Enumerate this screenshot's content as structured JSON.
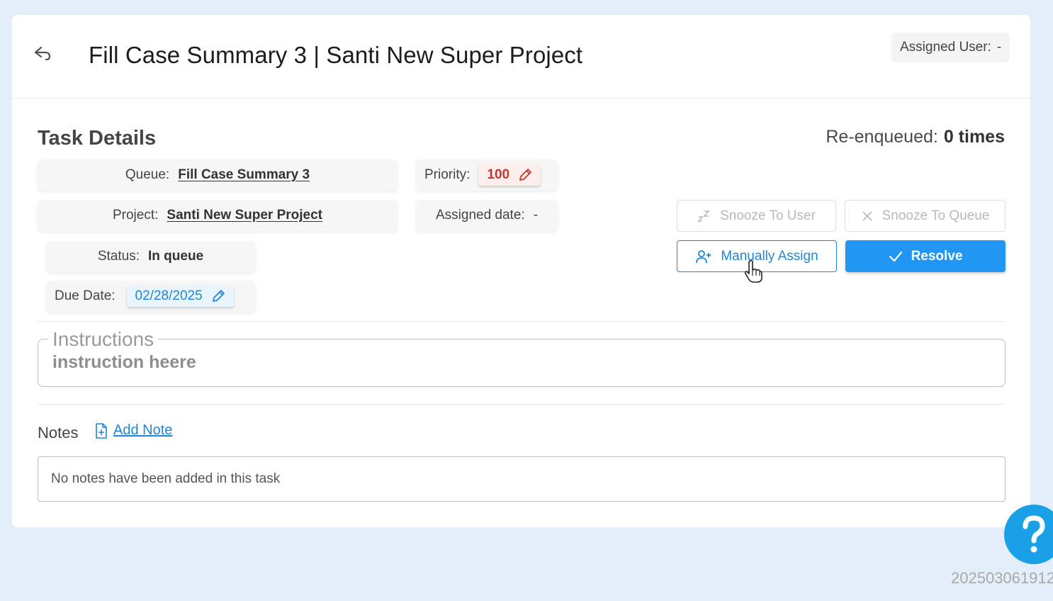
{
  "header": {
    "title": "Fill Case Summary 3 | Santi New Super Project",
    "assigned_user_label": "Assigned User:",
    "assigned_user_value": "-"
  },
  "task_details": {
    "title": "Task Details",
    "reenqueued_label": "Re-enqueued:",
    "reenqueued_value": "0 times",
    "queue_label": "Queue:",
    "queue_value": "Fill Case Summary 3",
    "project_label": "Project:",
    "project_value": "Santi New Super Project",
    "status_label": "Status:",
    "status_value": "In queue",
    "due_date_label": "Due Date:",
    "due_date_value": "02/28/2025",
    "priority_label": "Priority:",
    "priority_value": "100",
    "assigned_date_label": "Assigned date:",
    "assigned_date_value": "-"
  },
  "actions": {
    "snooze_user": "Snooze To User",
    "snooze_queue": "Snooze To Queue",
    "manually_assign": "Manually Assign",
    "resolve": "Resolve"
  },
  "instructions": {
    "legend": "Instructions",
    "text": "instruction heere"
  },
  "notes": {
    "label": "Notes",
    "add_note": "Add Note",
    "empty_text": "No notes have been added in this task"
  },
  "footer": {
    "build_id": "202503061912"
  },
  "colors": {
    "accent": "#2196f3",
    "priority": "#c0392b",
    "help": "#1aa0e6"
  }
}
